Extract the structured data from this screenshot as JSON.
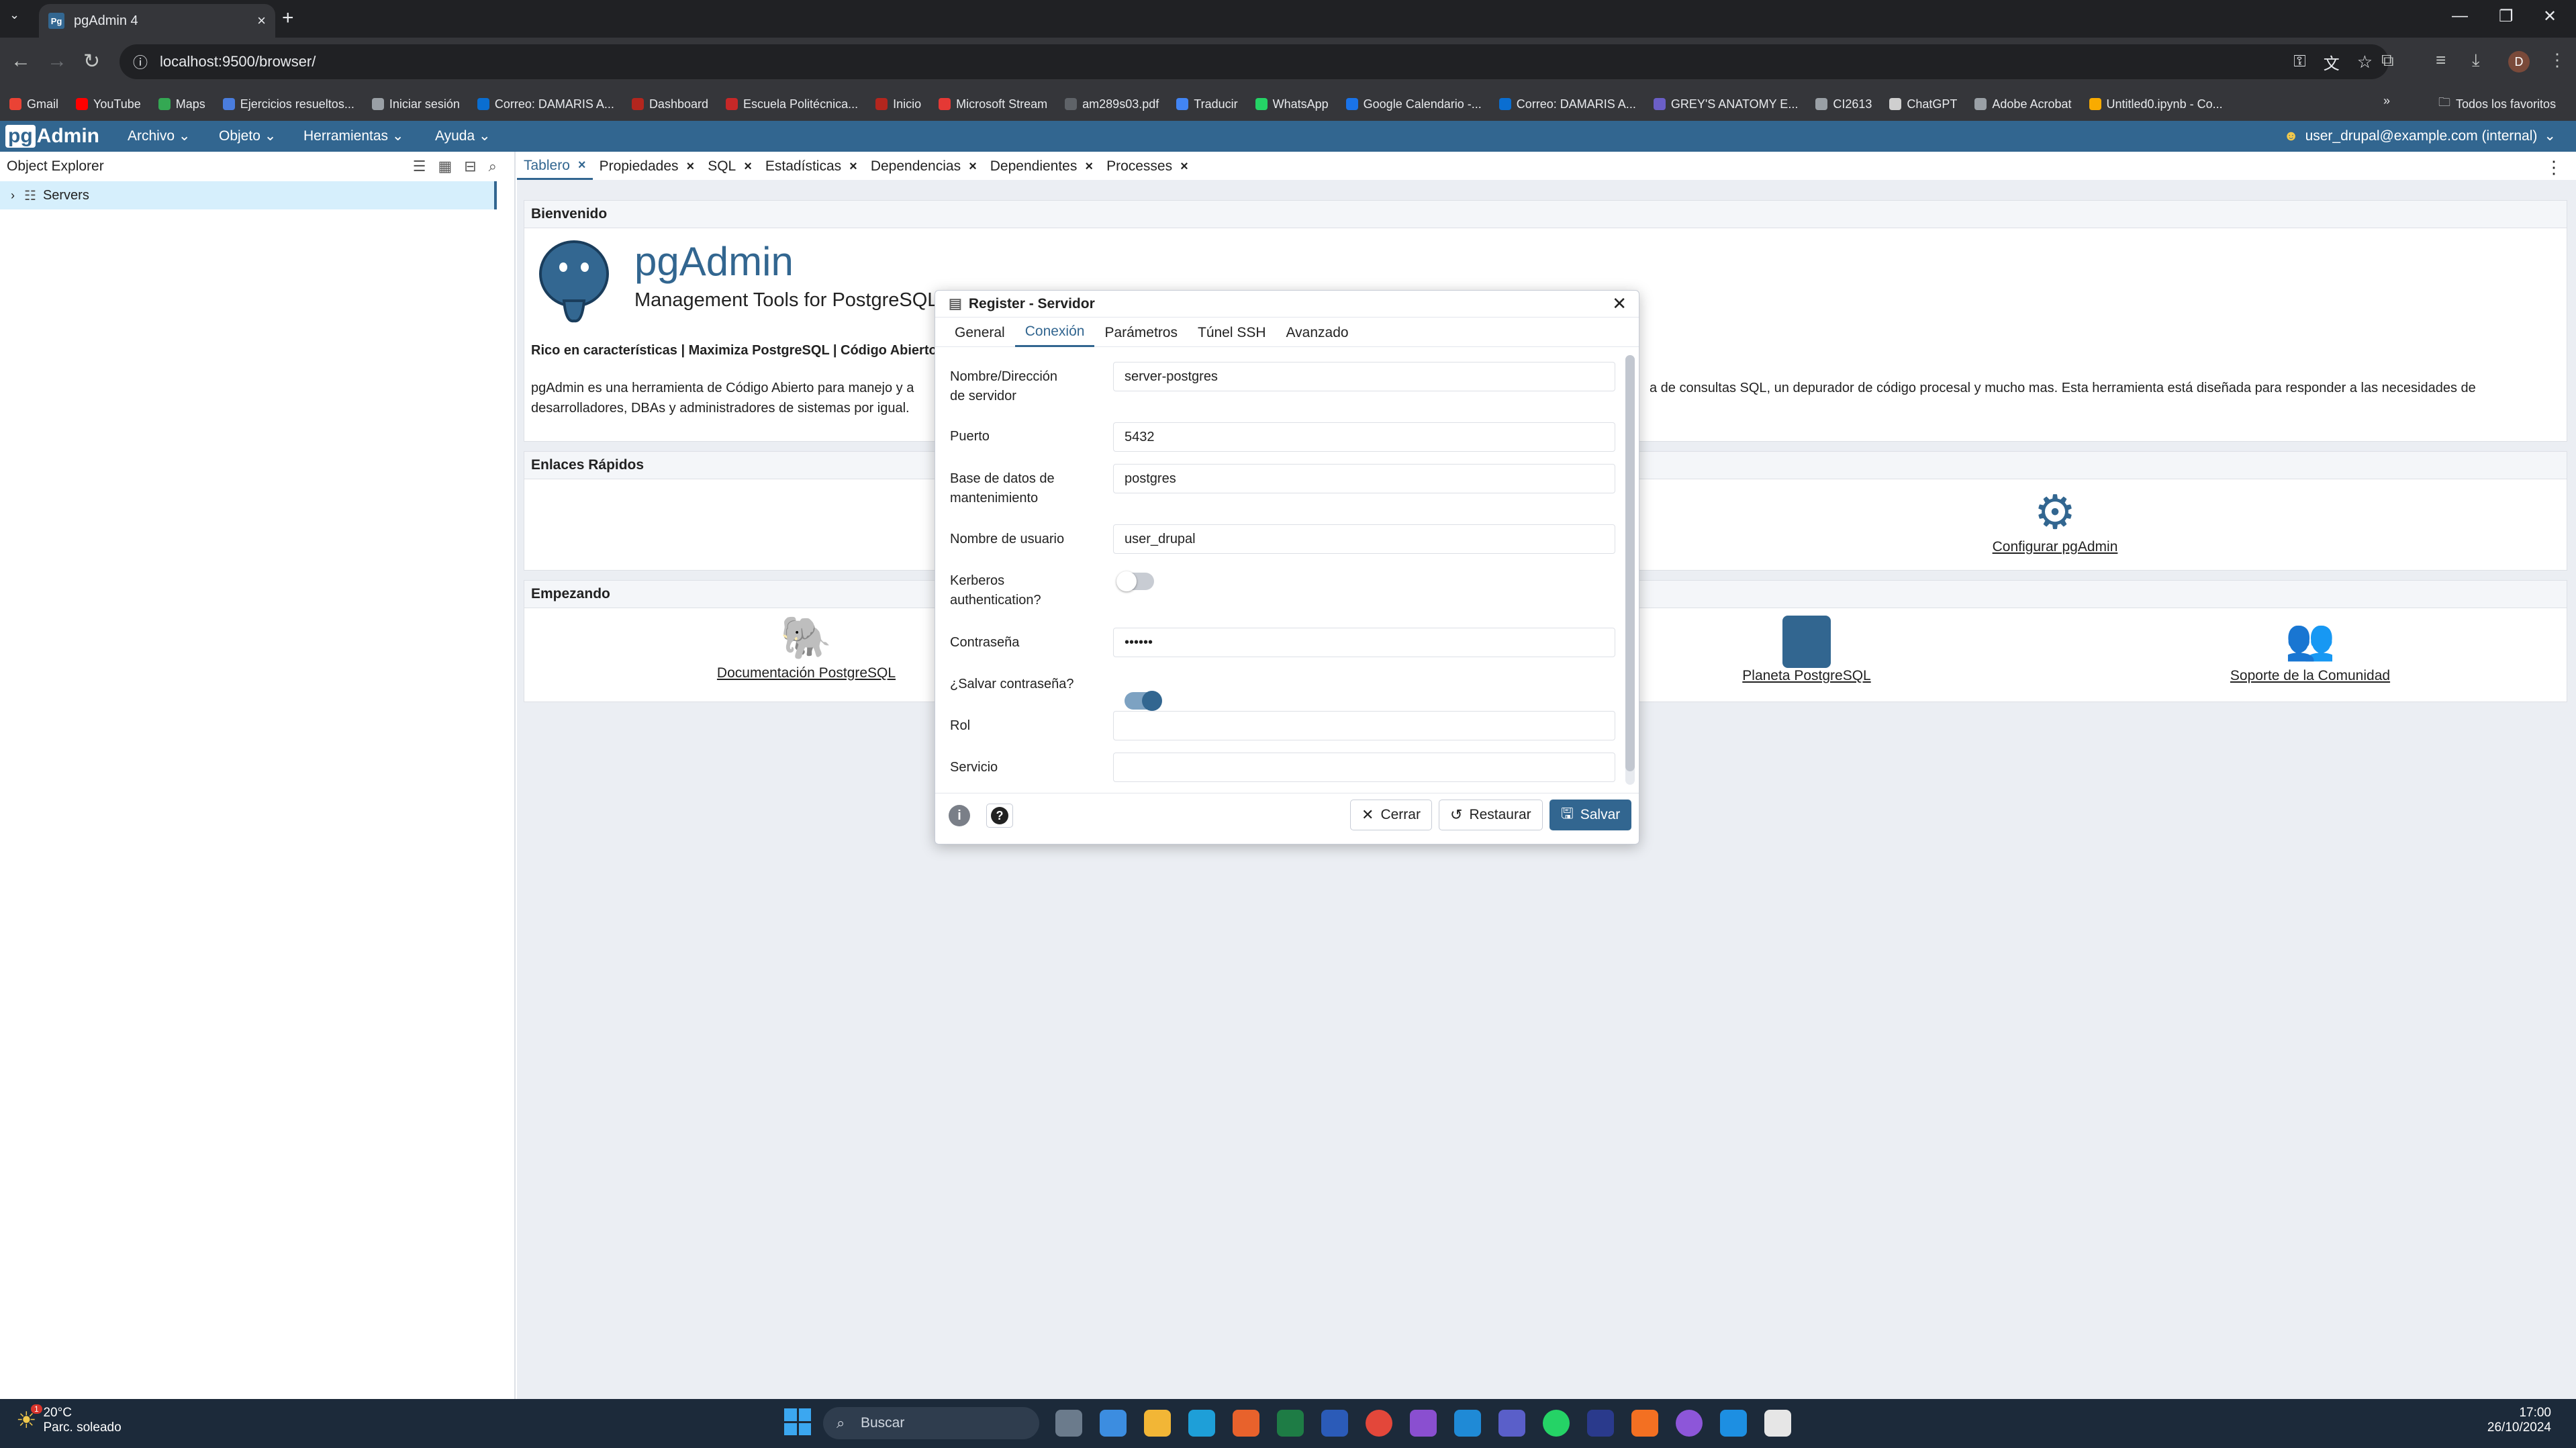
{
  "browser": {
    "tab_title": "pgAdmin 4",
    "url": "localhost:9500/browser/",
    "bookmarks": [
      "Gmail",
      "YouTube",
      "Maps",
      "Ejercicios resueltos...",
      "Iniciar sesión",
      "Correo: DAMARIS A...",
      "Dashboard",
      "Escuela Politécnica...",
      "Inicio",
      "Microsoft Stream",
      "am289s03.pdf",
      "Traducir",
      "WhatsApp",
      "Google Calendario -...",
      "Correo: DAMARIS A...",
      "GREY'S ANATOMY E...",
      "CI2613",
      "ChatGPT",
      "Adobe Acrobat",
      "Untitled0.ipynb - Co..."
    ],
    "all_bookmarks": "Todos los favoritos",
    "profile_initial": "D"
  },
  "pgadmin": {
    "logo_pg": "pg",
    "logo_admin": "Admin",
    "menus": [
      "Archivo",
      "Objeto",
      "Herramientas",
      "Ayuda"
    ],
    "user": "user_drupal@example.com (internal)"
  },
  "explorer": {
    "title": "Object Explorer",
    "tree_item": "Servers"
  },
  "content_tabs": [
    "Tablero",
    "Propiedades",
    "SQL",
    "Estadísticas",
    "Dependencias",
    "Dependientes",
    "Processes"
  ],
  "dashboard": {
    "welcome_title": "Bienvenido",
    "brand": "pgAdmin",
    "tagline": "Management Tools for PostgreSQL",
    "feature_line": "Rico en características | Maximiza PostgreSQL | Código Abierto",
    "desc_left_1": "pgAdmin es una herramienta de Código Abierto para manejo y a",
    "desc_left_2": "desarrolladores, DBAs y administradores de sistemas por igual.",
    "desc_right": "a de consultas SQL, un depurador de código procesal y mucho mas. Esta herramienta está diseñada para responder a las necesidades de",
    "quick_links_title": "Enlaces Rápidos",
    "configure_link": "Configurar pgAdmin",
    "getting_started_title": "Empezando",
    "doc_link": "Documentación PostgreSQL",
    "planet_link": "Planeta PostgreSQL",
    "support_link": "Soporte de la Comunidad"
  },
  "dialog": {
    "title": "Register - Servidor",
    "tabs": [
      "General",
      "Conexión",
      "Parámetros",
      "Túnel SSH",
      "Avanzado"
    ],
    "active_tab": "Conexión",
    "fields": {
      "host_label_1": "Nombre/Dirección",
      "host_label_2": "de servidor",
      "host_value": "server-postgres",
      "port_label": "Puerto",
      "port_value": "5432",
      "db_label_1": "Base de datos de",
      "db_label_2": "mantenimiento",
      "db_value": "postgres",
      "user_label": "Nombre de usuario",
      "user_value": "user_drupal",
      "kerberos_label_1": "Kerberos",
      "kerberos_label_2": "authentication?",
      "kerberos_on": false,
      "password_label": "Contraseña",
      "password_value": "••••••",
      "save_pw_label": "¿Salvar contraseña?",
      "save_pw_on": true,
      "role_label": "Rol",
      "role_value": "",
      "service_label": "Servicio",
      "service_value": ""
    },
    "buttons": {
      "close": "Cerrar",
      "reset": "Restaurar",
      "save": "Salvar"
    }
  },
  "taskbar": {
    "weather_temp": "20°C",
    "weather_desc": "Parc. soleado",
    "search_placeholder": "Buscar",
    "time": "17:00",
    "date": "26/10/2024",
    "notification_count": "1"
  },
  "colors": {
    "pgadmin_blue": "#326690",
    "chrome_dark": "#202124",
    "taskbar": "#1c2a3a"
  }
}
